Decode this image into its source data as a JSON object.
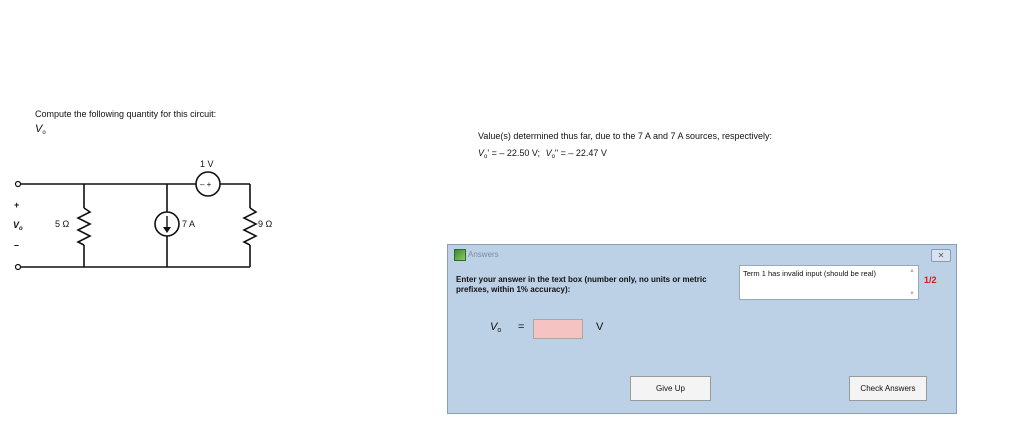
{
  "problem": {
    "prompt": "Compute the following quantity for this circuit:",
    "quantity": "V",
    "quantity_sub": "o"
  },
  "circuit": {
    "source_voltage_label": "1 V",
    "current_source_label": "7 A",
    "left_resistor_label": "5 Ω",
    "right_resistor_label": "9 Ω",
    "output_label": "V",
    "output_label_sub": "o",
    "plus_sign": "+",
    "minus_sign": "–",
    "vsource_polarity": "– +"
  },
  "status": {
    "heading": "Value(s) determined thus far, due to the 7 A and 7 A sources, respectively:",
    "v1_symbol": "V",
    "v1_sub": "o",
    "v1_mark": "'",
    "v1_value": " = – 22.50 V;",
    "v2_symbol": "V",
    "v2_sub": "o",
    "v2_mark": "\"",
    "v2_value": " = – 22.47 V"
  },
  "dialog": {
    "title": "Answers",
    "close_glyph": "✕",
    "instructions": "Enter your answer in the text box (number only, no units or metric prefixes, within 1% accuracy):",
    "feedback": "Term 1 has invalid input (should be real)",
    "attempts": "1/2",
    "answer_symbol": "V",
    "answer_sub": "o",
    "equals": "=",
    "answer_value": "",
    "answer_unit": "V",
    "give_up_label": "Give Up",
    "check_label": "Check Answers"
  },
  "colors": {
    "dialog_bg": "#bcd0e6",
    "input_invalid_bg": "#f6c3c3",
    "attempts_color": "#d21a1a"
  },
  "icons": [
    "answers-app-icon",
    "close-icon",
    "scroll-up-icon",
    "scroll-down-icon"
  ]
}
